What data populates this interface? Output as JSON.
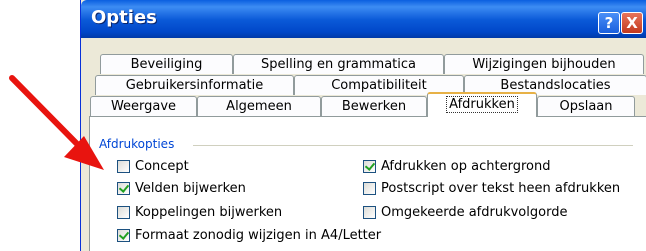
{
  "window": {
    "title": "Opties",
    "help_label": "?",
    "close_label": "X"
  },
  "tabs": {
    "row1": [
      "Beveiliging",
      "Spelling en grammatica",
      "Wijzigingen bijhouden"
    ],
    "row2": [
      "Gebruikersinformatie",
      "Compatibiliteit",
      "Bestandslocaties"
    ],
    "row3": [
      "Weergave",
      "Algemeen",
      "Bewerken",
      "Afdrukken",
      "Opslaan"
    ],
    "active": "Afdrukken"
  },
  "panel": {
    "group_title": "Afdrukopties",
    "left_options": [
      {
        "label": "Concept",
        "checked": false
      },
      {
        "label": "Velden bijwerken",
        "checked": true
      },
      {
        "label": "Koppelingen bijwerken",
        "checked": false
      },
      {
        "label": "Formaat zonodig wijzigen in A4/Letter",
        "checked": true
      }
    ],
    "right_options": [
      {
        "label": "Afdrukken op achtergrond",
        "checked": true
      },
      {
        "label": "Postscript over tekst heen afdrukken",
        "checked": false
      },
      {
        "label": "Omgekeerde afdrukvolgorde",
        "checked": false
      }
    ]
  },
  "colors": {
    "arrow": "#e8140f",
    "titlebar": "#0a5fe0",
    "active_tab_accent": "#e7b146",
    "group_title": "#0046d5"
  },
  "icons": {
    "annotation": "red-arrow-icon"
  }
}
